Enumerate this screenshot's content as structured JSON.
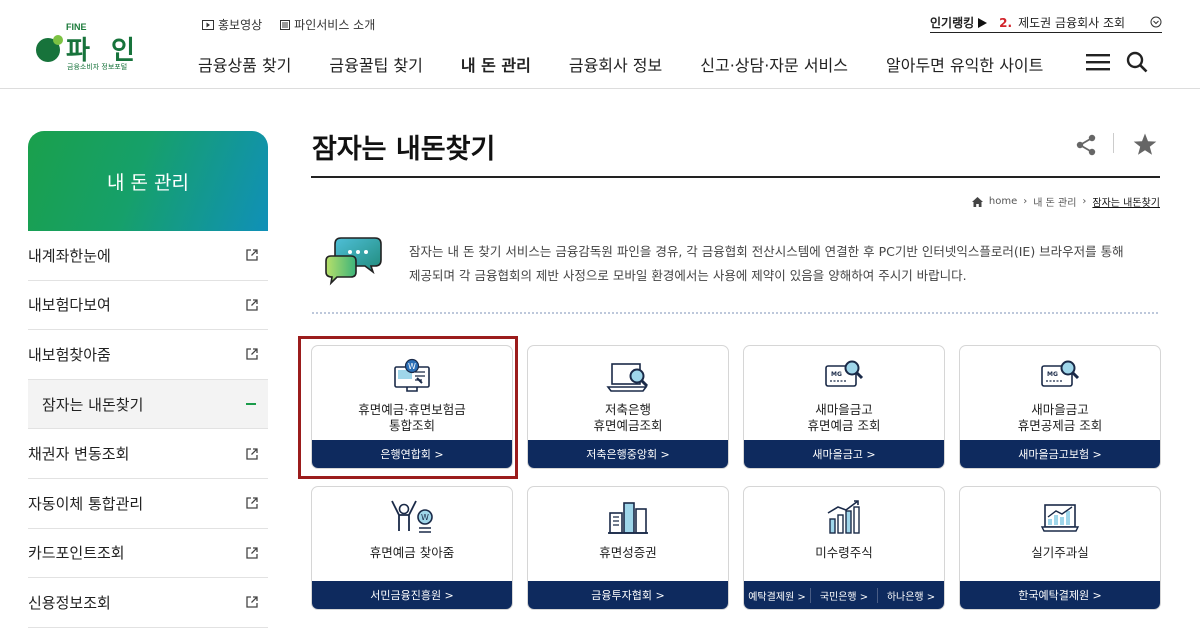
{
  "logo": {
    "fine": "FINE",
    "name": "파 인",
    "tagline": "금융소비자 정보포털"
  },
  "toplinks": [
    {
      "label": "홍보영상",
      "icon": "play-icon"
    },
    {
      "label": "파인서비스 소개",
      "icon": "document-icon"
    }
  ],
  "ranking": {
    "label": "인기랭킹",
    "rank": "2.",
    "text": "제도권 금융회사 조회"
  },
  "gnb": [
    "금융상품 찾기",
    "금융꿀팁 찾기",
    "내 돈 관리",
    "금융회사 정보",
    "신고·상담·자문 서비스",
    "알아두면 유익한 사이트"
  ],
  "gnb_active_index": 2,
  "sidebar": {
    "title": "내 돈 관리",
    "items": [
      {
        "label": "내계좌한눈에",
        "icon": "external-link-icon"
      },
      {
        "label": "내보험다보여",
        "icon": "external-link-icon"
      },
      {
        "label": "내보험찾아줌",
        "icon": "external-link-icon"
      },
      {
        "label": "잠자는 내돈찾기",
        "icon": "minus-icon",
        "active": true
      },
      {
        "label": "채권자 변동조회",
        "icon": "external-link-icon"
      },
      {
        "label": "자동이체 통합관리",
        "icon": "external-link-icon"
      },
      {
        "label": "카드포인트조회",
        "icon": "external-link-icon"
      },
      {
        "label": "신용정보조회",
        "icon": "external-link-icon"
      }
    ]
  },
  "page": {
    "title": "잠자는 내돈찾기"
  },
  "breadcrumb": {
    "home": "home",
    "level1": "내 돈 관리",
    "current": "잠자는 내돈찾기"
  },
  "intro": {
    "line1": "잠자는 내 돈 찾기 서비스는 금융감독원 파인을 경유, 각 금융협회 전산시스템에 연결한 후 PC기반 인터넷익스플로러(IE) 브라우저를 통해",
    "line2": "제공되며 각 금융협회의 제반 사정으로 모바일 환경에서는 사용에 제약이 있음을 양해하여 주시기 바랍니다."
  },
  "cards": [
    {
      "line1": "휴면예금·휴면보험금",
      "line2": "통합조회",
      "foot": "은행연합회 >",
      "icon": "monitor-won-icon"
    },
    {
      "line1": "저축은행",
      "line2": "휴면예금조회",
      "foot": "저축은행중앙회 >",
      "icon": "laptop-search-icon"
    },
    {
      "line1": "새마을금고",
      "line2": "휴면예금 조회",
      "foot": "새마을금고 >",
      "icon": "card-search-icon",
      "brand": "MG"
    },
    {
      "line1": "새마을금고",
      "line2": "휴면공제금 조회",
      "foot": "새마을금고보험 >",
      "icon": "card-search-icon",
      "brand": "MG"
    },
    {
      "line1": "휴면예금 찾아줌",
      "line2": "",
      "foot": "서민금융진흥원 >",
      "icon": "person-coin-icon"
    },
    {
      "line1": "휴면성증권",
      "line2": "",
      "foot": "금융투자협회 >",
      "icon": "building-chart-icon"
    },
    {
      "line1": "미수령주식",
      "line2": "",
      "foots": [
        "예탁결제원 >",
        "국민은행 >",
        "하나은행 >"
      ],
      "icon": "bar-chart-icon"
    },
    {
      "line1": "실기주과실",
      "line2": "",
      "foot": "한국예탁결제원 >",
      "icon": "trend-board-icon"
    }
  ]
}
